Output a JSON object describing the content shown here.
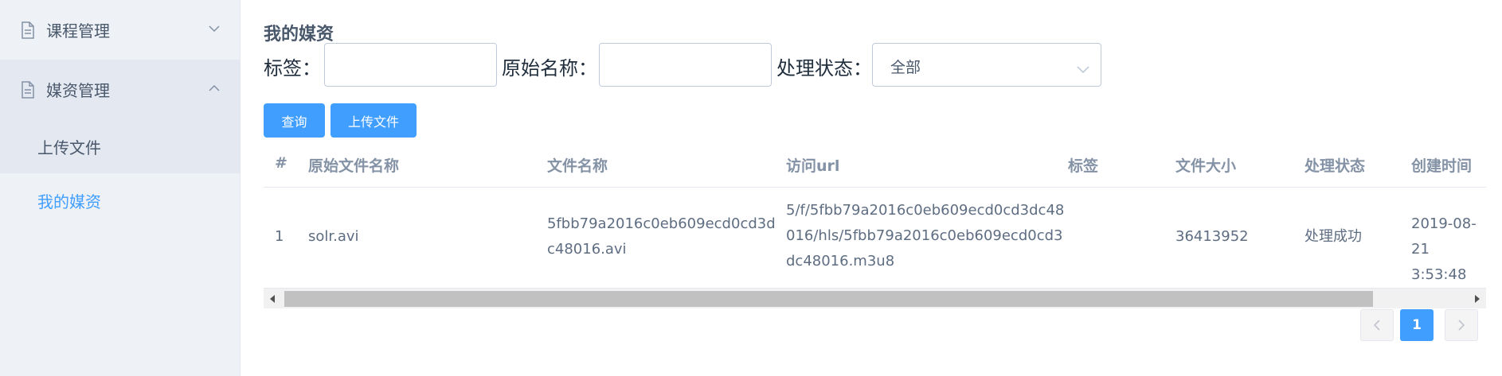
{
  "sidebar": {
    "menus": [
      {
        "label": "课程管理",
        "expanded": false
      },
      {
        "label": "媒资管理",
        "expanded": true,
        "items": [
          {
            "label": "上传文件"
          },
          {
            "label": "我的媒资",
            "active": true
          }
        ]
      }
    ]
  },
  "main": {
    "title": "我的媒资",
    "filters": {
      "tag_label": "标签：",
      "tag_value": "",
      "name_label": "原始名称：",
      "name_value": "",
      "status_label": "处理状态：",
      "status_value": "全部"
    },
    "buttons": {
      "query": "查询",
      "upload": "上传文件"
    },
    "table": {
      "headers": [
        "#",
        "原始文件名称",
        "文件名称",
        "访问url",
        "标签",
        "文件大小",
        "处理状态",
        "创建时间"
      ],
      "rows": [
        {
          "index": "1",
          "original_name": "solr.avi",
          "file_name_lines": [
            "5fbb79a2016c0eb609ecd0cd3d",
            "c48016.avi"
          ],
          "url_lines": [
            "5/f/5fbb79a2016c0eb609ecd0cd3dc48",
            "016/hls/5fbb79a2016c0eb609ecd0cd3",
            "dc48016.m3u8"
          ],
          "tag": "",
          "size": "36413952",
          "status": "处理成功",
          "created_lines": [
            "2019-08-21",
            "3:53:48"
          ]
        }
      ]
    },
    "pagination": {
      "current": "1"
    }
  },
  "colors": {
    "accent": "#409eff",
    "sidebar_bg": "#eef1f6",
    "sidebar_active_bg": "#e4e8f1"
  }
}
